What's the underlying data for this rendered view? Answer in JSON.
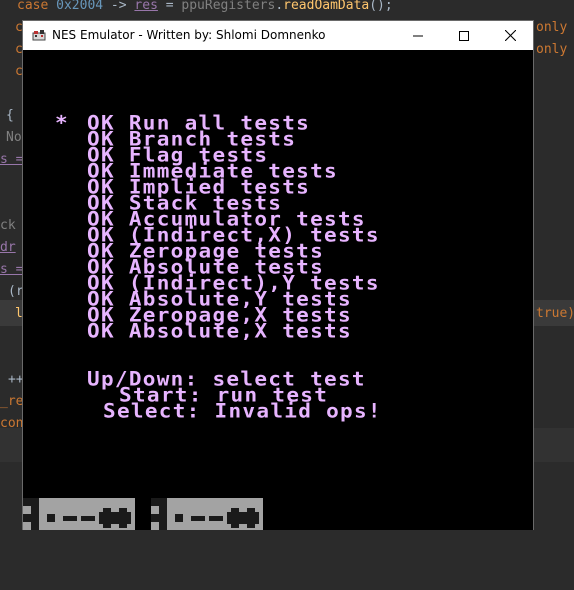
{
  "editor": {
    "line1": {
      "kw": "case",
      "num": "0x2004",
      "arrow": " -> ",
      "var": "res",
      "eq": " = ",
      "obj": "ppuRegisters",
      "dot": ".",
      "fn": "readOamData",
      "end": "();"
    },
    "left_fragments": [
      "c",
      "c",
      "c",
      "{",
      "No",
      "s =",
      "ck",
      "dr",
      "s =",
      "(r",
      "l",
      "++",
      "_re",
      "con"
    ],
    "right_fragments": [
      "only",
      "only",
      "true)"
    ]
  },
  "window": {
    "title": "NES Emulator - Written by: Shlomi Domnenko",
    "controls": {
      "minimize": "minimize-icon",
      "maximize": "maximize-icon",
      "close": "close-icon"
    }
  },
  "screen": {
    "cursor": "*",
    "tests": [
      {
        "status": "OK",
        "name": "Run all tests"
      },
      {
        "status": "OK",
        "name": "Branch tests"
      },
      {
        "status": "OK",
        "name": "Flag tests"
      },
      {
        "status": "OK",
        "name": "Immediate tests"
      },
      {
        "status": "OK",
        "name": "Implied tests"
      },
      {
        "status": "OK",
        "name": "Stack tests"
      },
      {
        "status": "OK",
        "name": "Accumulator tests"
      },
      {
        "status": "OK",
        "name": "(Indirect,X) tests"
      },
      {
        "status": "OK",
        "name": "Zeropage tests"
      },
      {
        "status": "OK",
        "name": "Absolute tests"
      },
      {
        "status": "OK",
        "name": "(Indirect),Y tests"
      },
      {
        "status": "OK",
        "name": "Absolute,Y tests"
      },
      {
        "status": "OK",
        "name": "Zeropage,X tests"
      },
      {
        "status": "OK",
        "name": "Absolute,X tests"
      }
    ],
    "help": [
      "Up/Down: select test",
      "Start: run test",
      "Select: Invalid ops!"
    ],
    "colors": {
      "text": "#e7b4ff",
      "background": "#000000",
      "badge": "#a3a3a3"
    }
  }
}
